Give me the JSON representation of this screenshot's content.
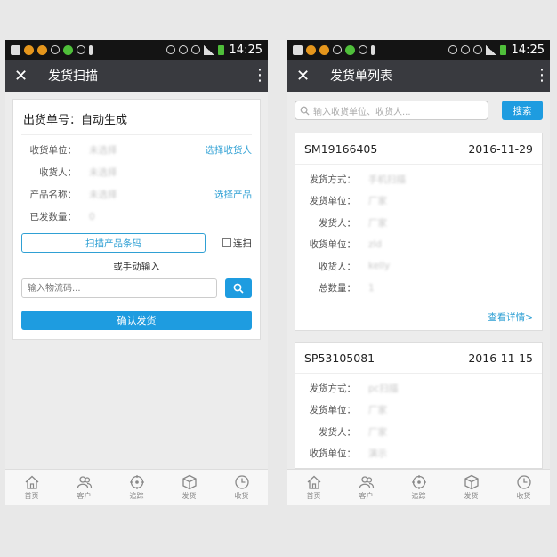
{
  "status_bar": {
    "time": "14:25"
  },
  "left": {
    "title": "发货扫描",
    "order_title": "出货单号：自动生成",
    "fields": [
      {
        "label": "收货单位：",
        "value": "未选择",
        "action": "选择收货人"
      },
      {
        "label": "收货人：",
        "value": "未选择",
        "action": ""
      },
      {
        "label": "产品名称：",
        "value": "未选择",
        "action": "选择产品"
      },
      {
        "label": "已发数量：",
        "value": "0",
        "action": ""
      }
    ],
    "scan_button": "扫描产品条码",
    "continuous_label": "连扫",
    "manual_text": "或手动输入",
    "code_placeholder": "输入物流码...",
    "confirm_button": "确认发货"
  },
  "right": {
    "title": "发货单列表",
    "search_placeholder": "输入收货单位、收货人...",
    "search_button": "搜索",
    "orders": [
      {
        "id": "SM19166405",
        "date": "2016-11-29",
        "rows": [
          {
            "label": "发货方式：",
            "value": "手机扫描"
          },
          {
            "label": "发货单位：",
            "value": "厂家"
          },
          {
            "label": "发货人：",
            "value": "厂家"
          },
          {
            "label": "收货单位：",
            "value": "zld"
          },
          {
            "label": "收货人：",
            "value": "kelly"
          },
          {
            "label": "总数量：",
            "value": "1"
          }
        ],
        "detail_link": "查看详情>"
      },
      {
        "id": "SP53105081",
        "date": "2016-11-15",
        "rows": [
          {
            "label": "发货方式：",
            "value": "pc扫描"
          },
          {
            "label": "发货单位：",
            "value": "厂家"
          },
          {
            "label": "发货人：",
            "value": "厂家"
          },
          {
            "label": "收货单位：",
            "value": "演示"
          }
        ]
      }
    ]
  },
  "tabs": [
    {
      "label": "首页",
      "icon": "home-icon"
    },
    {
      "label": "客户",
      "icon": "customers-icon"
    },
    {
      "label": "追踪",
      "icon": "track-icon"
    },
    {
      "label": "发货",
      "icon": "box-icon"
    },
    {
      "label": "收货",
      "icon": "clock-icon"
    }
  ],
  "colors": {
    "accent": "#1e9ce0",
    "link": "#2fa0d4",
    "titlebar": "#393a3f"
  }
}
